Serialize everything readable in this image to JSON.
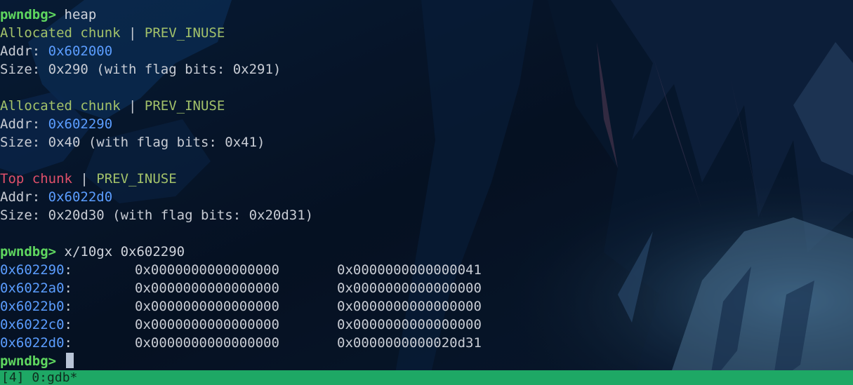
{
  "prompt": "pwndbg>",
  "commands": {
    "heap": "heap",
    "examine": "x/10gx 0x602290"
  },
  "chunks": [
    {
      "type": "Allocated chunk",
      "sep": " | ",
      "flag": "PREV_INUSE",
      "addr_label": "Addr: ",
      "addr": "0x602000",
      "size_text": "Size: 0x290 (with flag bits: 0x291)"
    },
    {
      "type": "Allocated chunk",
      "sep": " | ",
      "flag": "PREV_INUSE",
      "addr_label": "Addr: ",
      "addr": "0x602290",
      "size_text": "Size: 0x40 (with flag bits: 0x41)"
    },
    {
      "type": "Top chunk",
      "sep": " | ",
      "flag": "PREV_INUSE",
      "addr_label": "Addr: ",
      "addr": "0x6022d0",
      "size_text": "Size: 0x20d30 (with flag bits: 0x20d31)"
    }
  ],
  "memory": [
    {
      "addr": "0x602290",
      "q1": "0x0000000000000000",
      "q2": "0x0000000000000041"
    },
    {
      "addr": "0x6022a0",
      "q1": "0x0000000000000000",
      "q2": "0x0000000000000000"
    },
    {
      "addr": "0x6022b0",
      "q1": "0x0000000000000000",
      "q2": "0x0000000000000000"
    },
    {
      "addr": "0x6022c0",
      "q1": "0x0000000000000000",
      "q2": "0x0000000000000000"
    },
    {
      "addr": "0x6022d0",
      "q1": "0x0000000000000000",
      "q2": "0x0000000000020d31"
    }
  ],
  "statusbar": {
    "text": "[4] 0:gdb*"
  },
  "colors": {
    "prompt": "#5fd75f",
    "allocated": "#a3c26a",
    "top_chunk": "#e0506a",
    "address": "#5b9dff",
    "statusbar": "#1ea865"
  }
}
